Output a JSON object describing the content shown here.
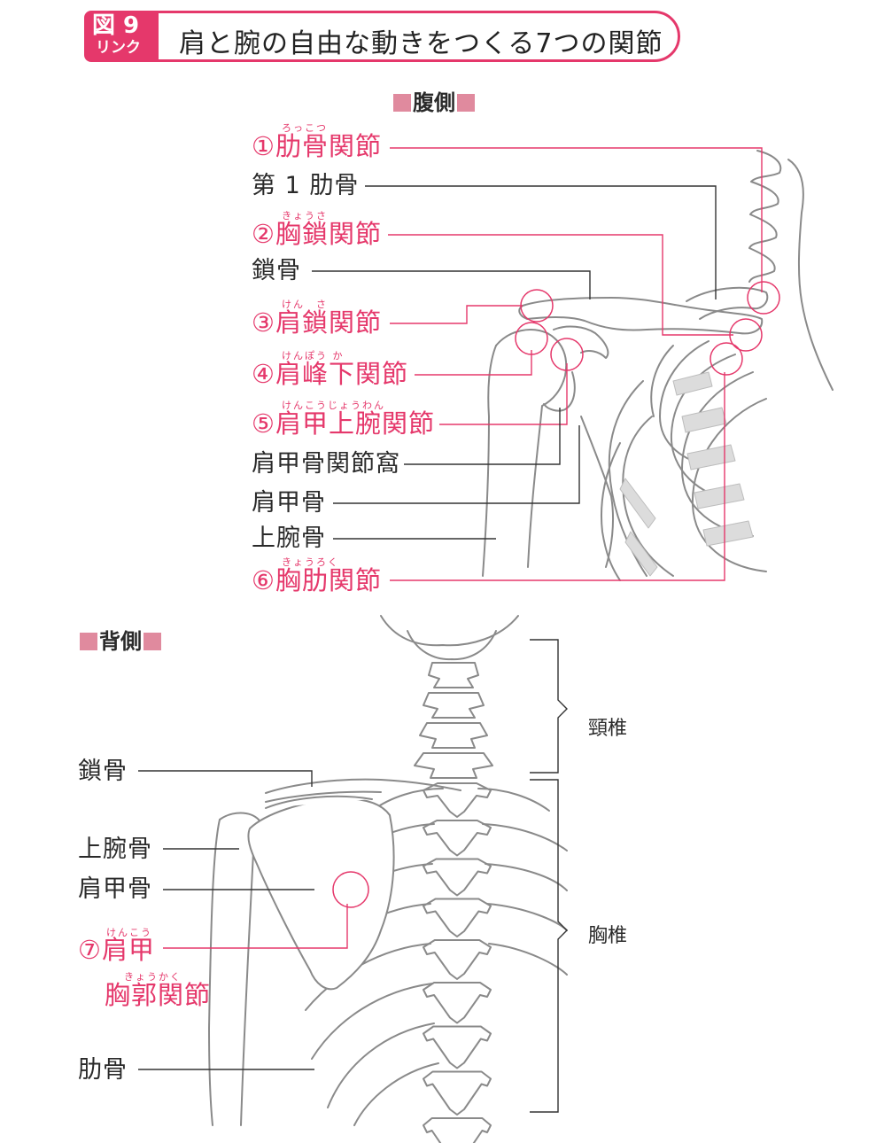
{
  "header": {
    "figure_label": "図 9",
    "link_label": "リンク",
    "title": "肩と腕の自由な動きをつくる7つの関節"
  },
  "front_view": {
    "section_title": "腹側",
    "labels": {
      "rib_joint": "①肋骨関節",
      "rib_joint_ruby": "ろっこつ",
      "first_rib": "第 1 肋骨",
      "sternoclavicular": "②胸鎖関節",
      "sternoclavicular_ruby": "きょうさ",
      "clavicle": "鎖骨",
      "acromioclavicular": "③肩鎖関節",
      "acromioclavicular_ruby": "けん　さ",
      "subacromial": "④肩峰下関節",
      "subacromial_ruby": "けんぽう か",
      "glenohumeral": "⑤肩甲上腕関節",
      "glenohumeral_ruby": "けんこうじょうわん",
      "glenoid_fossa": "肩甲骨関節窩",
      "scapula": "肩甲骨",
      "humerus": "上腕骨",
      "sternocostal": "⑥胸肋関節",
      "sternocostal_ruby": "きょうろく"
    }
  },
  "back_view": {
    "section_title": "背側",
    "labels": {
      "clavicle": "鎖骨",
      "humerus": "上腕骨",
      "scapula": "肩甲骨",
      "scapulothoracic_1": "⑦肩甲",
      "scapulothoracic_2": "胸郭関節",
      "scapulothoracic_ruby_1": "けんこう",
      "scapulothoracic_ruby_2": "きょうかく",
      "rib": "肋骨",
      "cervical": "頸椎",
      "thoracic": "胸椎"
    }
  },
  "colors": {
    "accent": "#e5386b",
    "leader_dark": "#333333",
    "bone_outline": "#8a8a8a",
    "cartilage": "#d9d9d9",
    "section_square": "#e08a9e"
  }
}
